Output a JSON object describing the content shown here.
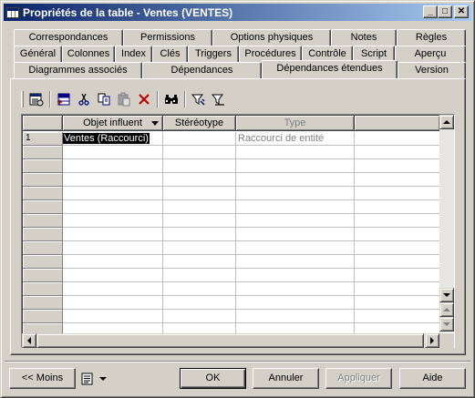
{
  "window": {
    "title": "Propriétés de la table - Ventes (VENTES)",
    "minimize": "_",
    "maximize": "□",
    "close": "✕"
  },
  "tabs": {
    "row1": [
      "Correspondances",
      "Permissions",
      "Options physiques",
      "Notes",
      "Règles"
    ],
    "row2": [
      "Général",
      "Colonnes",
      "Index",
      "Clés",
      "Triggers",
      "Procédures",
      "Contrôle",
      "Script",
      "Aperçu"
    ],
    "row3": [
      "Diagrammes associés",
      "Dépendances",
      "Dépendances étendues",
      "Version"
    ],
    "active": "Dépendances étendues"
  },
  "toolbar": {
    "icons": [
      "properties-icon",
      "add-rows-icon",
      "cut-icon",
      "copy-icon",
      "paste-icon",
      "delete-icon",
      "find-icon",
      "filter-icon",
      "filter-clear-icon"
    ]
  },
  "grid": {
    "columns": [
      {
        "label": "Objet influent",
        "has_dropdown": true,
        "muted": false
      },
      {
        "label": "Stéréotype",
        "has_dropdown": false,
        "muted": false
      },
      {
        "label": "Type",
        "has_dropdown": false,
        "muted": true
      }
    ],
    "rows": [
      {
        "num": "1",
        "objet": "Ventes (Raccourci)",
        "stereotype": "",
        "type": "Raccourci de entité"
      }
    ],
    "empty_row_count": 14
  },
  "buttons": {
    "moins": "<< Moins",
    "ok": "OK",
    "annuler": "Annuler",
    "appliquer": "Appliquer",
    "aide": "Aide"
  }
}
